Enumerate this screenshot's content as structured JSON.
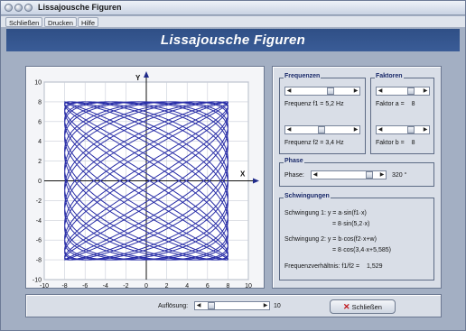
{
  "window": {
    "title": "Lissajousche Figuren"
  },
  "menu": {
    "items": [
      "Schließen",
      "Drucken",
      "Hilfe"
    ]
  },
  "banner": {
    "title": "Lissajousche Figuren"
  },
  "plot": {
    "x_axis_label": "X",
    "y_axis_label": "Y",
    "x_ticks": [
      "-10",
      "-8",
      "-6",
      "-4",
      "-2",
      "0",
      "2",
      "4",
      "6",
      "8",
      "10"
    ],
    "y_ticks": [
      "10",
      "8",
      "6",
      "4",
      "2",
      "0",
      "-2",
      "-4",
      "-6",
      "-8",
      "-10"
    ],
    "curve_color": "#2a2fa8"
  },
  "frequenzen": {
    "title": "Frequenzen",
    "f1_label": "Frequenz f1 = 5,2 Hz",
    "f2_label": "Frequenz f2 = 3,4 Hz",
    "f1_level": 0.66,
    "f2_level": 0.48
  },
  "faktoren": {
    "title": "Faktoren",
    "a_label": "Faktor a =",
    "a_value": "8",
    "b_label": "Faktor b =",
    "b_value": "8",
    "a_level": 0.75,
    "b_level": 0.75
  },
  "phase": {
    "title": "Phase",
    "label": "Phase:",
    "value": "320 °",
    "level": 0.89
  },
  "schwingungen": {
    "title": "Schwingungen",
    "line1": "Schwingung 1:  y = a·sin(f1·x)",
    "line1b": "= 8·sin(5,2·x)",
    "line2": "Schwingung 2:  y = b·cos(f2·x+w)",
    "line2b": "= 8·cos(3,4·x+5,585)",
    "ratio_label": "Frequenzverhältnis:   f1/f2  =",
    "ratio_value": "1,529"
  },
  "bottom": {
    "aufloesung_label": "Auflösung:",
    "aufloesung_value": "10",
    "aufloesung_level": 0.1,
    "close_button": "Schließen"
  }
}
